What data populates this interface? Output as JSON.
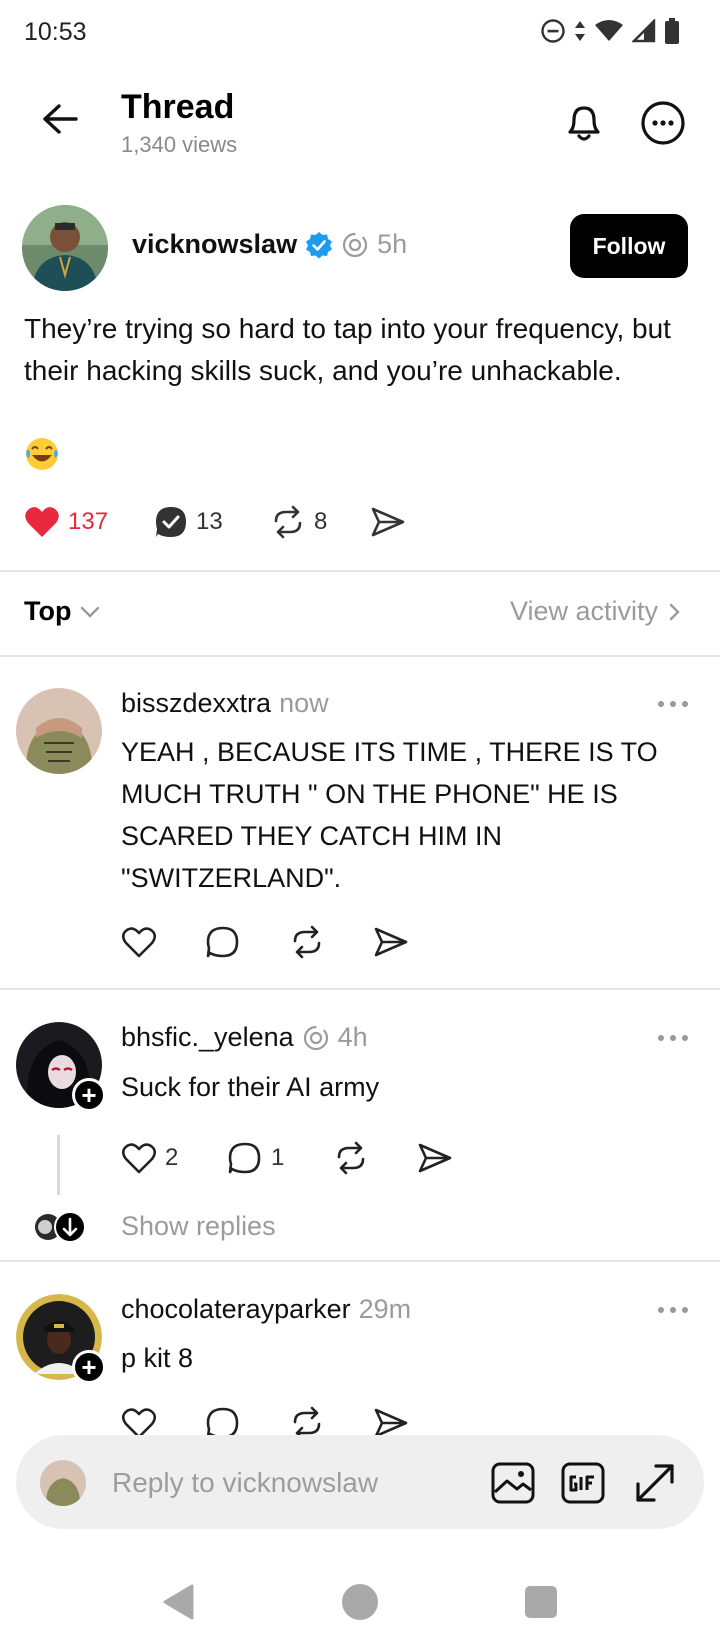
{
  "status_bar": {
    "time": "10:53"
  },
  "header": {
    "title": "Thread",
    "views": "1,340 views"
  },
  "post": {
    "username": "vicknowslaw",
    "time": "5h",
    "follow_label": "Follow",
    "text": "They’re trying so hard to tap into your frequency, but their hacking skills suck, and you’re unhackable.",
    "likes": "137",
    "replies": "13",
    "reposts": "8",
    "accent": "#e0245e",
    "verified_color": "#1d9bf0"
  },
  "sort": {
    "label": "Top",
    "view_activity": "View activity"
  },
  "replies": [
    {
      "username": "bisszdexxtra",
      "time": "now",
      "text": "YEAH , BECAUSE ITS TIME , THERE IS TO MUCH TRUTH \" ON THE PHONE\" HE IS SCARED THEY CATCH HIM IN \"SWITZERLAND\"."
    },
    {
      "username": "bhsfic._yelena",
      "time": "4h",
      "text": "Suck for their AI army",
      "likes": "2",
      "replies": "1",
      "show_replies": "Show replies"
    },
    {
      "username": "chocolaterayparker",
      "time": "29m",
      "text": "p kit 8"
    }
  ],
  "reply_bar": {
    "placeholder": "Reply to vicknowslaw"
  }
}
